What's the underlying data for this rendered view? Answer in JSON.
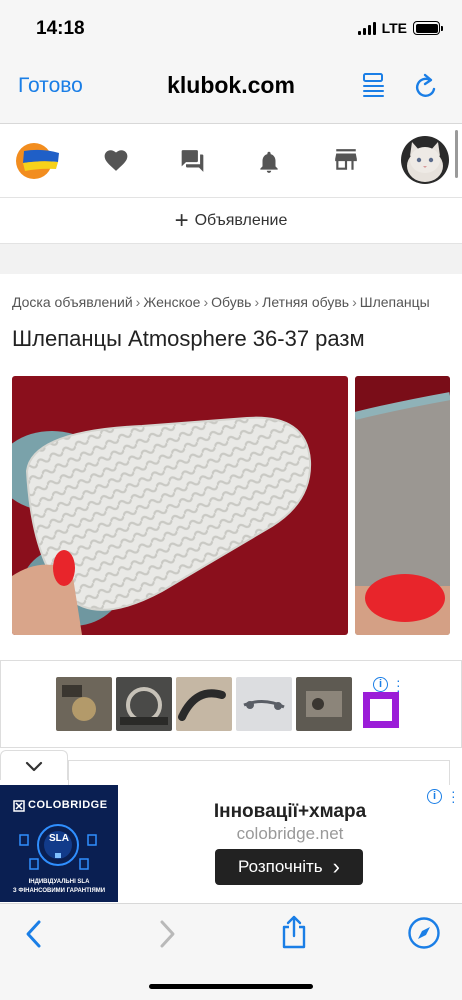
{
  "status_bar": {
    "time": "14:18",
    "network": "LTE"
  },
  "browser": {
    "done_label": "Готово",
    "site_title": "klubok.com"
  },
  "site_nav": {
    "post_button_label": "Объявление"
  },
  "breadcrumb": [
    "Доска объявлений",
    "Женское",
    "Обувь",
    "Летняя обувь",
    "Шлепанцы"
  ],
  "breadcrumb_separator": "›",
  "listing": {
    "title": "Шлепанцы Atmosphere 36-37 разм"
  },
  "ad_strip": {
    "info_glyph": "i"
  },
  "banner": {
    "brand": "COLOBRIDGE",
    "badge": "SLA",
    "tagline_line1": "ІНДИВІДУАЛЬНІ SLA",
    "tagline_line2": "З ФІНАНСОВИМИ ГАРАНТІЯМИ",
    "title": "Інновації+хмара",
    "url": "colobridge.net",
    "cta_label": "Розпочніть",
    "cta_arrow": "›"
  },
  "colors": {
    "accent": "#1a7ee6",
    "photo_background": "#8a0f1c",
    "nail_polish": "#e8252b",
    "ad_purple": "#9b1dd8",
    "banner_bg": "#0a1f52"
  },
  "icons": {
    "nav": [
      "ukraine-logo",
      "heart-icon",
      "messages-icon",
      "bell-icon",
      "store-icon",
      "avatar"
    ],
    "toolbar": [
      "back-icon",
      "forward-icon",
      "share-icon",
      "compass-icon"
    ]
  }
}
